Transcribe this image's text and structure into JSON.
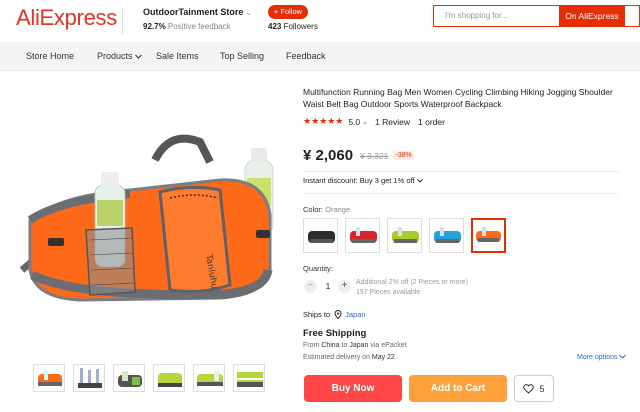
{
  "header": {
    "logo": "AliExpress",
    "store_name": "OutdoorTainment Store",
    "store_chevron": "⌄",
    "feedback_pct": "92.7%",
    "feedback_label": "Positive feedback",
    "follow_label": "+ Follow",
    "followers_count": "423",
    "followers_label": "Followers",
    "search_placeholder": "I'm shopping for...",
    "search_button": "On AliExpress"
  },
  "nav": {
    "items": [
      "Store Home",
      "Products",
      "Sale Items",
      "Top Selling",
      "Feedback"
    ]
  },
  "product": {
    "title": "Multifunction Running Bag Men Women Cycling Climbing Hiking Jogging Shoulder Waist Belt Bag Outdoor Sports Waterproof Backpack",
    "rating_score": "5.0",
    "reviews": "1 Review",
    "orders": "1 order",
    "price": "¥ 2,060",
    "old_price": "¥ 3,321",
    "discount": "-38%",
    "instant_discount": "Instant discount: Buy 3 get 1% off",
    "color_label": "Color:",
    "color_value": "Orange",
    "quantity_label": "Quantity:",
    "quantity_value": "1",
    "qty_info_1": "Additional 2% off (2 Pieces or more)",
    "qty_info_2": "197 Pieces available",
    "ships_to_label": "Ships to",
    "ships_to": "Japan",
    "free_shipping": "Free Shipping",
    "from_prefix": "From",
    "from_country": "China",
    "to_word": "to",
    "to_country": "Japan",
    "via": "via ePacket",
    "est_prefix": "Estimated delivery on",
    "est_date": "May 22",
    "more_options": "More options",
    "buy_now": "Buy Now",
    "add_to_cart": "Add to Cart",
    "wishlist_count": "5"
  },
  "colors": {
    "accent": "#e62e04",
    "buy_now": "#ff4747",
    "add_to_cart": "#ffa13a",
    "bag_orange": "#ff6a1a",
    "bag_gray": "#6b6d72",
    "link": "#2e6bd6"
  },
  "swatches": [
    "black",
    "red",
    "green",
    "blue",
    "orange"
  ],
  "icons": [
    "heart-icon",
    "location-pin-icon",
    "chevron-down-icon"
  ]
}
